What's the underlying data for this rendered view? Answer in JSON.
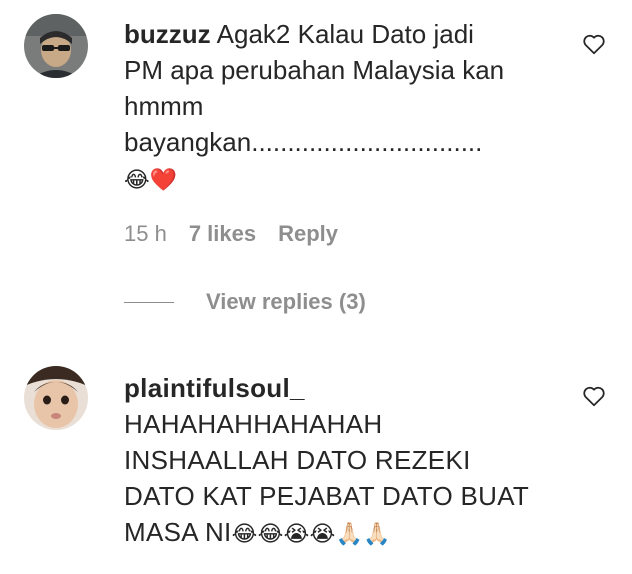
{
  "comments": [
    {
      "username": "buzzuz",
      "text_lines": [
        "Agak2 Kalau Dato jadi",
        "PM apa perubahan Malaysia kan",
        "hmmm",
        "bayangkan................................"
      ],
      "emojis": "😂❤️",
      "time": "15 h",
      "likes": "7 likes",
      "reply_label": "Reply",
      "view_replies": "View replies (3)"
    },
    {
      "username": "plaintifulsoul_",
      "text_lines": [
        "HAHAHAHHAHAHAH",
        "INSHAALLAH DATO REZEKI",
        "DATO KAT PEJABAT DATO BUAT",
        "MASA NI"
      ],
      "emojis": "😂😂😭😭🙏🏻🙏🏻"
    }
  ],
  "icons": {
    "like": "heart-outline-icon"
  }
}
